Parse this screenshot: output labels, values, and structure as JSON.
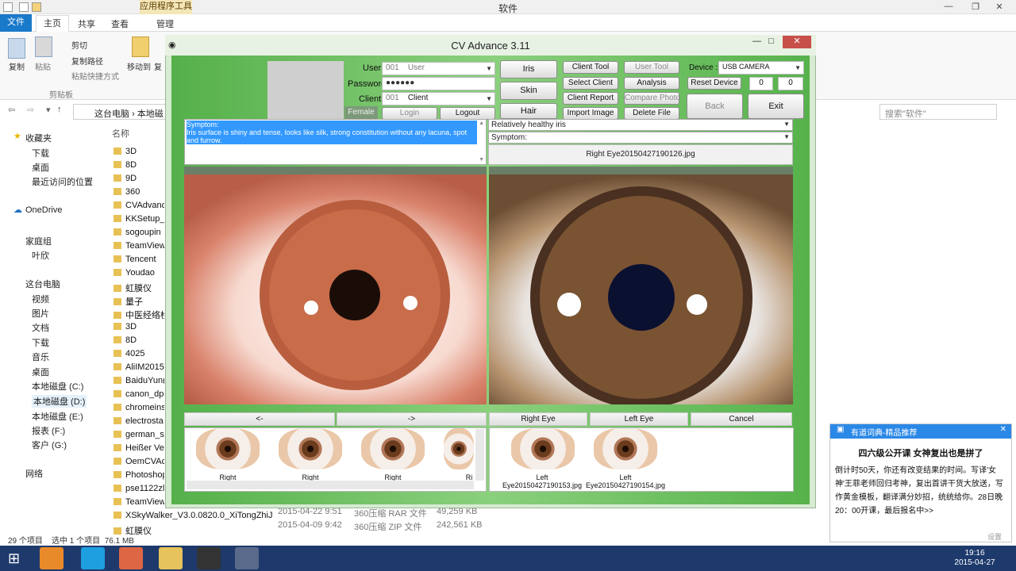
{
  "explorer": {
    "title": "软件",
    "context_tab": "应用程序工具",
    "tabs": {
      "file": "文件",
      "home": "主页",
      "share": "共享",
      "view": "查看",
      "manage": "管理"
    },
    "ribbon": {
      "copy": "复制",
      "paste": "粘贴",
      "cut": "剪切",
      "copy_path": "复制路径",
      "paste_shortcut": "粘贴快捷方式",
      "clipboard": "剪贴板",
      "move_to": "移动到",
      "copy_to": "复"
    },
    "breadcrumb": {
      "pc": "这台电脑",
      "sep": "›",
      "drive": "本地磁"
    },
    "search_placeholder": "搜索\"软件\"",
    "nav": {
      "favorites": "收藏夹",
      "downloads": "下载",
      "desktop": "桌面",
      "recent": "最近访问的位置",
      "onedrive": "OneDrive",
      "homegroup": "家庭组",
      "user": "叶欣",
      "thispc": "这台电脑",
      "videos": "视频",
      "pictures": "图片",
      "documents": "文档",
      "downloads2": "下载",
      "music": "音乐",
      "desktop2": "桌面",
      "driveC": "本地磁盘 (C:)",
      "driveD": "本地磁盘 (D:)",
      "driveE": "本地磁盘 (E:)",
      "driveF": "报表 (F:)",
      "driveG": "客户 (G:)",
      "network": "网络"
    },
    "name_header": "名称",
    "files": [
      "3D",
      "8D",
      "9D",
      "360",
      "CVAdvanc",
      "KKSetup_",
      "sogoupin",
      "TeamView",
      "Tencent",
      "Youdao",
      "虹膜仪",
      "量子",
      "中医经络检",
      "3D",
      "8D",
      "4025",
      "AliIM2015",
      "BaiduYun(",
      "canon_dp",
      "chromeins",
      "electrosta",
      "german_s",
      "Heißer Ve",
      "OemCVAc",
      "Photoshop",
      "pse1122zl",
      "TeamView",
      "XSkyWalker_V3.0.0820.0_XiTongZhiJia",
      "虹膜仪"
    ],
    "detail_rows": [
      {
        "date": "2015-04-22  9:51",
        "type": "360压缩 RAR 文件",
        "size": "49,259 KB"
      },
      {
        "date": "2015-04-09  9:42",
        "type": "360压缩 ZIP 文件",
        "size": "242,561 KB"
      }
    ],
    "status": {
      "count": "29 个项目",
      "selected": "选中 1 个项目",
      "size": "76.1 MB"
    }
  },
  "app": {
    "title": "CV Advance 3.11",
    "labels": {
      "user": "User",
      "password": "Password",
      "client": "Client"
    },
    "user_id": "001",
    "user_name": "User",
    "password": "●●●●●●",
    "client_id": "001",
    "client_name": "Client",
    "female": "Female",
    "login": "Login",
    "logout": "Logout",
    "btn_iris": "Iris",
    "btn_skin": "Skin",
    "btn_hair": "Hair",
    "btn_client_tool": "Client Tool",
    "btn_user_tool": "User Tool",
    "btn_select_client": "Select Client",
    "btn_analysis": "Analysis",
    "btn_client_report": "Client Report",
    "btn_compare_photo": "Compare Photo",
    "btn_import_image": "Import Image",
    "btn_delete_file": "Delete File",
    "device_label": "Device :",
    "device_value": "USB CAMERA",
    "btn_reset_device": "Reset Device",
    "count_a": "0",
    "count_b": "0",
    "btn_back": "Back",
    "btn_exit": "Exit",
    "symptom_left": "Symptom:\nIris surface is shiny and tense, looks like silk, strong constitution without any lacuna, spot and furrow.",
    "symptom_right_1": "Relatively healthy iris",
    "symptom_right_2": "Symptom:",
    "filename": "Right Eye20150427190126.jpg",
    "btn_prev": "<-",
    "btn_next": "->",
    "btn_right_eye": "Right Eye",
    "btn_left_eye": "Left Eye",
    "btn_cancel": "Cancel",
    "thumbs_left": [
      "Right",
      "Right",
      "Right",
      "Ri"
    ],
    "thumbs_right": [
      "Left\nEye20150427190153.jpg",
      "Left\nEye20150427190154.jpg"
    ]
  },
  "notification": {
    "header": "有道词典-精品推荐",
    "title": "四六级公开课 女神复出也是拼了",
    "body": "倒计时50天，你还有改变结果的时间。写译'女神'王菲老师回归考神，复出首讲干货大放送，写作黄金模板，翻译满分妙招，统统给你。28日晚20：00开课，最后报名中>>",
    "settings": "设置"
  },
  "clock": {
    "time": "19:16",
    "date": "2015-04-27"
  }
}
